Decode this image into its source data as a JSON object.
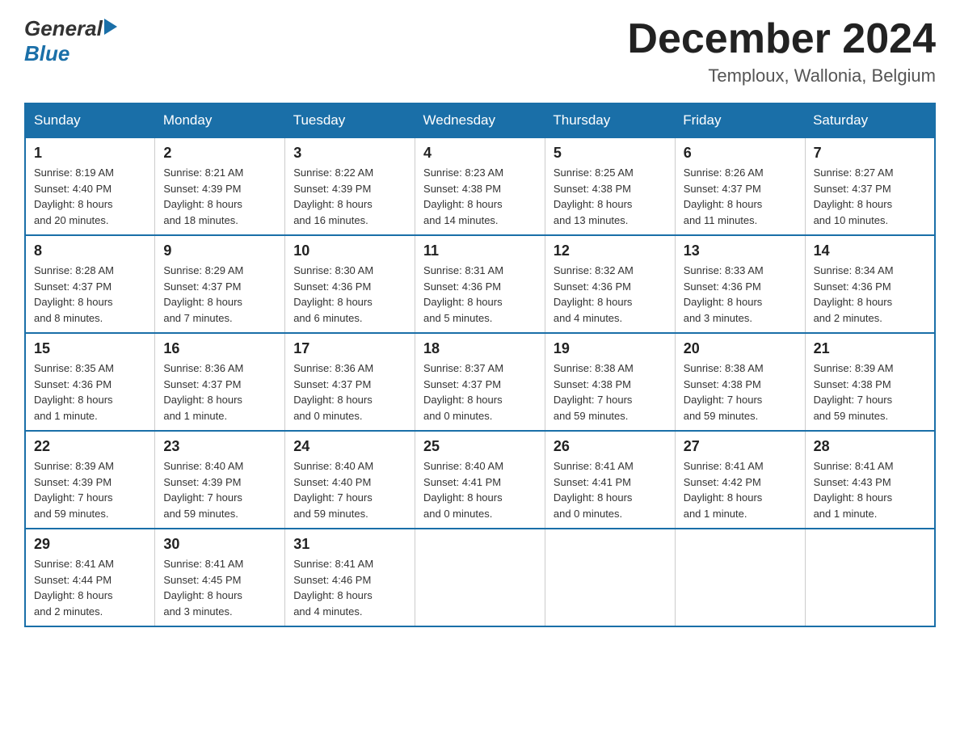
{
  "header": {
    "logo_general": "General",
    "logo_blue": "Blue",
    "month_title": "December 2024",
    "location": "Temploux, Wallonia, Belgium"
  },
  "days_of_week": [
    "Sunday",
    "Monday",
    "Tuesday",
    "Wednesday",
    "Thursday",
    "Friday",
    "Saturday"
  ],
  "weeks": [
    [
      {
        "day": "1",
        "sunrise": "Sunrise: 8:19 AM",
        "sunset": "Sunset: 4:40 PM",
        "daylight": "Daylight: 8 hours and 20 minutes."
      },
      {
        "day": "2",
        "sunrise": "Sunrise: 8:21 AM",
        "sunset": "Sunset: 4:39 PM",
        "daylight": "Daylight: 8 hours and 18 minutes."
      },
      {
        "day": "3",
        "sunrise": "Sunrise: 8:22 AM",
        "sunset": "Sunset: 4:39 PM",
        "daylight": "Daylight: 8 hours and 16 minutes."
      },
      {
        "day": "4",
        "sunrise": "Sunrise: 8:23 AM",
        "sunset": "Sunset: 4:38 PM",
        "daylight": "Daylight: 8 hours and 14 minutes."
      },
      {
        "day": "5",
        "sunrise": "Sunrise: 8:25 AM",
        "sunset": "Sunset: 4:38 PM",
        "daylight": "Daylight: 8 hours and 13 minutes."
      },
      {
        "day": "6",
        "sunrise": "Sunrise: 8:26 AM",
        "sunset": "Sunset: 4:37 PM",
        "daylight": "Daylight: 8 hours and 11 minutes."
      },
      {
        "day": "7",
        "sunrise": "Sunrise: 8:27 AM",
        "sunset": "Sunset: 4:37 PM",
        "daylight": "Daylight: 8 hours and 10 minutes."
      }
    ],
    [
      {
        "day": "8",
        "sunrise": "Sunrise: 8:28 AM",
        "sunset": "Sunset: 4:37 PM",
        "daylight": "Daylight: 8 hours and 8 minutes."
      },
      {
        "day": "9",
        "sunrise": "Sunrise: 8:29 AM",
        "sunset": "Sunset: 4:37 PM",
        "daylight": "Daylight: 8 hours and 7 minutes."
      },
      {
        "day": "10",
        "sunrise": "Sunrise: 8:30 AM",
        "sunset": "Sunset: 4:36 PM",
        "daylight": "Daylight: 8 hours and 6 minutes."
      },
      {
        "day": "11",
        "sunrise": "Sunrise: 8:31 AM",
        "sunset": "Sunset: 4:36 PM",
        "daylight": "Daylight: 8 hours and 5 minutes."
      },
      {
        "day": "12",
        "sunrise": "Sunrise: 8:32 AM",
        "sunset": "Sunset: 4:36 PM",
        "daylight": "Daylight: 8 hours and 4 minutes."
      },
      {
        "day": "13",
        "sunrise": "Sunrise: 8:33 AM",
        "sunset": "Sunset: 4:36 PM",
        "daylight": "Daylight: 8 hours and 3 minutes."
      },
      {
        "day": "14",
        "sunrise": "Sunrise: 8:34 AM",
        "sunset": "Sunset: 4:36 PM",
        "daylight": "Daylight: 8 hours and 2 minutes."
      }
    ],
    [
      {
        "day": "15",
        "sunrise": "Sunrise: 8:35 AM",
        "sunset": "Sunset: 4:36 PM",
        "daylight": "Daylight: 8 hours and 1 minute."
      },
      {
        "day": "16",
        "sunrise": "Sunrise: 8:36 AM",
        "sunset": "Sunset: 4:37 PM",
        "daylight": "Daylight: 8 hours and 1 minute."
      },
      {
        "day": "17",
        "sunrise": "Sunrise: 8:36 AM",
        "sunset": "Sunset: 4:37 PM",
        "daylight": "Daylight: 8 hours and 0 minutes."
      },
      {
        "day": "18",
        "sunrise": "Sunrise: 8:37 AM",
        "sunset": "Sunset: 4:37 PM",
        "daylight": "Daylight: 8 hours and 0 minutes."
      },
      {
        "day": "19",
        "sunrise": "Sunrise: 8:38 AM",
        "sunset": "Sunset: 4:38 PM",
        "daylight": "Daylight: 7 hours and 59 minutes."
      },
      {
        "day": "20",
        "sunrise": "Sunrise: 8:38 AM",
        "sunset": "Sunset: 4:38 PM",
        "daylight": "Daylight: 7 hours and 59 minutes."
      },
      {
        "day": "21",
        "sunrise": "Sunrise: 8:39 AM",
        "sunset": "Sunset: 4:38 PM",
        "daylight": "Daylight: 7 hours and 59 minutes."
      }
    ],
    [
      {
        "day": "22",
        "sunrise": "Sunrise: 8:39 AM",
        "sunset": "Sunset: 4:39 PM",
        "daylight": "Daylight: 7 hours and 59 minutes."
      },
      {
        "day": "23",
        "sunrise": "Sunrise: 8:40 AM",
        "sunset": "Sunset: 4:39 PM",
        "daylight": "Daylight: 7 hours and 59 minutes."
      },
      {
        "day": "24",
        "sunrise": "Sunrise: 8:40 AM",
        "sunset": "Sunset: 4:40 PM",
        "daylight": "Daylight: 7 hours and 59 minutes."
      },
      {
        "day": "25",
        "sunrise": "Sunrise: 8:40 AM",
        "sunset": "Sunset: 4:41 PM",
        "daylight": "Daylight: 8 hours and 0 minutes."
      },
      {
        "day": "26",
        "sunrise": "Sunrise: 8:41 AM",
        "sunset": "Sunset: 4:41 PM",
        "daylight": "Daylight: 8 hours and 0 minutes."
      },
      {
        "day": "27",
        "sunrise": "Sunrise: 8:41 AM",
        "sunset": "Sunset: 4:42 PM",
        "daylight": "Daylight: 8 hours and 1 minute."
      },
      {
        "day": "28",
        "sunrise": "Sunrise: 8:41 AM",
        "sunset": "Sunset: 4:43 PM",
        "daylight": "Daylight: 8 hours and 1 minute."
      }
    ],
    [
      {
        "day": "29",
        "sunrise": "Sunrise: 8:41 AM",
        "sunset": "Sunset: 4:44 PM",
        "daylight": "Daylight: 8 hours and 2 minutes."
      },
      {
        "day": "30",
        "sunrise": "Sunrise: 8:41 AM",
        "sunset": "Sunset: 4:45 PM",
        "daylight": "Daylight: 8 hours and 3 minutes."
      },
      {
        "day": "31",
        "sunrise": "Sunrise: 8:41 AM",
        "sunset": "Sunset: 4:46 PM",
        "daylight": "Daylight: 8 hours and 4 minutes."
      },
      null,
      null,
      null,
      null
    ]
  ]
}
